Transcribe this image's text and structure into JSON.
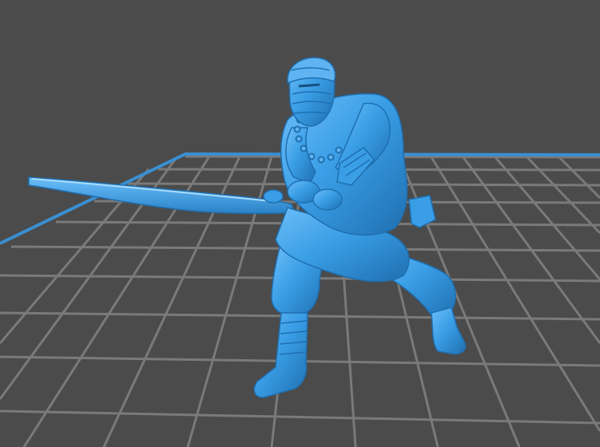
{
  "scene": {
    "background_color": "#4b4b4b",
    "grid_color": "#7a7a7a",
    "grid_border_color": "#3a8fd1",
    "model_color": "#3a9ee6",
    "model_shadow_color": "#1f6fb0",
    "model_highlight_color": "#7cc6ff",
    "model_icon": "3d-miniature-model-icon"
  }
}
